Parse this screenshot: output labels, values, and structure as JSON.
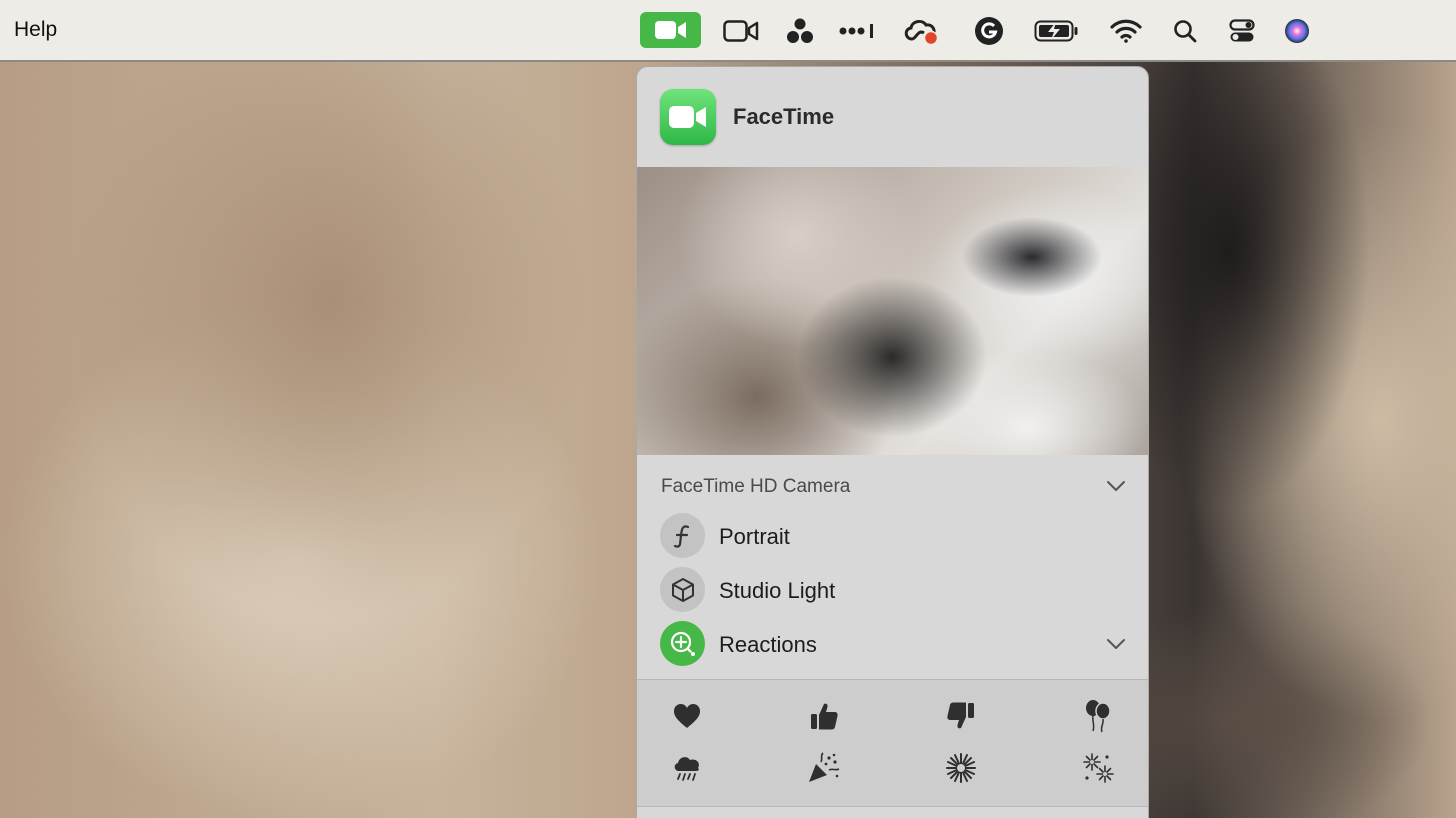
{
  "menubar": {
    "help_label": "Help",
    "status_icons": [
      "facetime-icon",
      "video-camera-icon",
      "people-icon",
      "signal-dots-icon",
      "creative-cloud-icon",
      "grammarly-icon",
      "battery-charging-icon",
      "wifi-icon",
      "search-icon",
      "control-center-icon",
      "siri-icon"
    ]
  },
  "panel": {
    "app_name": "FaceTime",
    "camera_label": "FaceTime HD Camera",
    "options": [
      {
        "label": "Portrait",
        "icon": "aperture-icon"
      },
      {
        "label": "Studio Light",
        "icon": "cube-icon"
      },
      {
        "label": "Reactions",
        "icon": "reactions-icon"
      }
    ],
    "reactions": [
      "heart-icon",
      "thumbs-up-icon",
      "thumbs-down-icon",
      "balloons-icon",
      "rain-icon",
      "confetti-icon",
      "fireworks-icon",
      "sparkles-icon"
    ]
  },
  "colors": {
    "accent_green": "#46b847",
    "menubar_bg": "#eeece7",
    "panel_bg": "#d8d8d8"
  }
}
